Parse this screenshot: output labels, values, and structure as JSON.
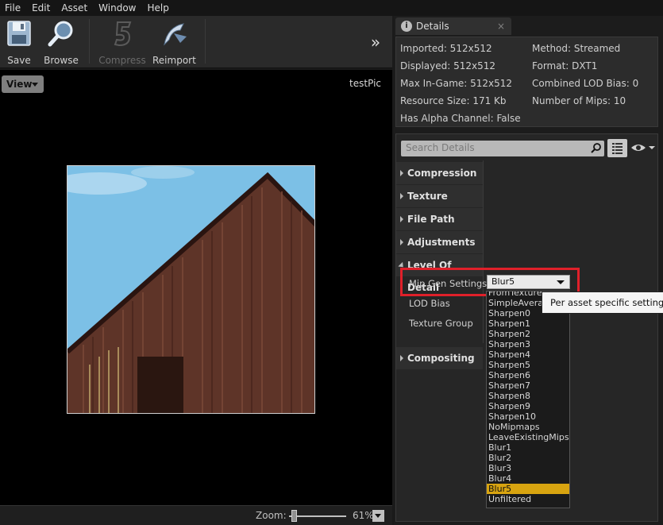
{
  "menu": [
    "File",
    "Edit",
    "Asset",
    "Window",
    "Help"
  ],
  "toolbar": {
    "save": "Save",
    "browse": "Browse",
    "compress": "Compress",
    "reimport": "Reimport"
  },
  "viewport": {
    "view_label": "View",
    "asset_name": "testPic",
    "zoom_label": "Zoom:",
    "zoom_value": "61%",
    "zoom_fraction": 0.1
  },
  "details_tab": {
    "title": "Details"
  },
  "texture_info": {
    "imported": "Imported: 512x512",
    "displayed": "Displayed: 512x512",
    "max_in_game": "Max In-Game: 512x512",
    "resource_size": "Resource Size: 171 Kb",
    "has_alpha": "Has Alpha Channel: False",
    "method": "Method: Streamed",
    "format": "Format: DXT1",
    "combined_lod_bias": "Combined LOD Bias: 0",
    "num_mips": "Number of Mips: 10"
  },
  "search": {
    "placeholder": "Search Details"
  },
  "categories": {
    "compression": "Compression",
    "texture": "Texture",
    "file_path": "File Path",
    "adjustments": "Adjustments",
    "level_of_detail": "Level Of Detail",
    "compositing": "Compositing"
  },
  "lod": {
    "mip_gen_label": "Mip Gen Settings",
    "mip_gen_value": "Blur5",
    "lod_bias_label": "LOD Bias",
    "texture_group_label": "Texture Group"
  },
  "tooltip": "Per asset specific setting to",
  "mip_options": [
    "FromTextureGroup",
    "SimpleAverage",
    "Sharpen0",
    "Sharpen1",
    "Sharpen2",
    "Sharpen3",
    "Sharpen4",
    "Sharpen5",
    "Sharpen6",
    "Sharpen7",
    "Sharpen8",
    "Sharpen9",
    "Sharpen10",
    "NoMipmaps",
    "LeaveExistingMips",
    "Blur1",
    "Blur2",
    "Blur3",
    "Blur4",
    "Blur5",
    "Unfiltered"
  ],
  "selected_option": "Blur5",
  "colors": {
    "highlight": "#e0202a",
    "selection": "#d8a410",
    "sky": "#7cc0e6",
    "barn": "#5e3428"
  }
}
